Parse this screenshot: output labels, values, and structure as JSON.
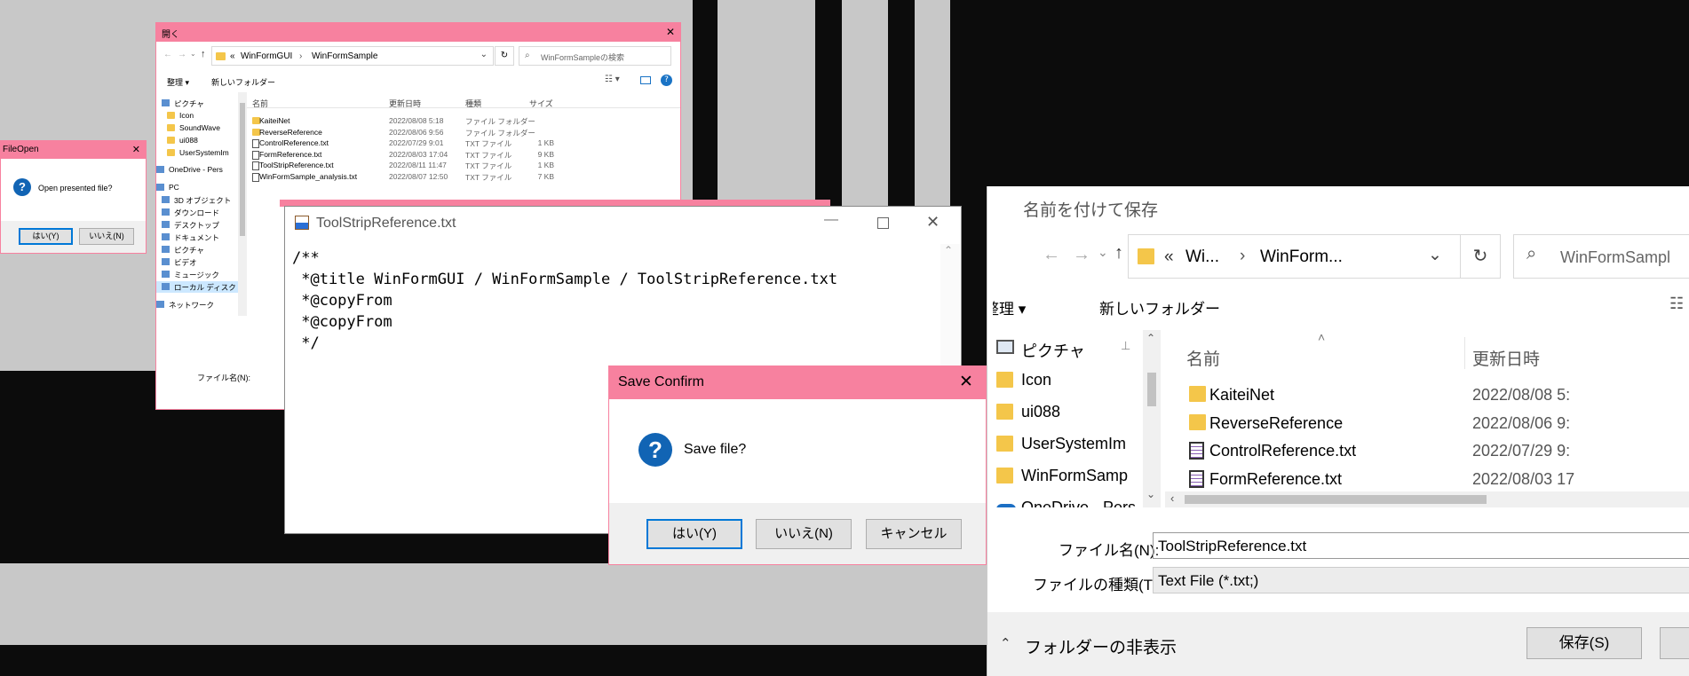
{
  "open_dialog": {
    "title": "開く",
    "close": "✕",
    "path_sep": "«",
    "path1": "WinFormGUI",
    "path_arrow": "›",
    "path2": "WinFormSample",
    "search_placeholder": "WinFormSampleの検索",
    "organize": "整理 ▾",
    "new_folder": "新しいフォルダー",
    "nav_items": [
      {
        "label": "ピクチャ"
      },
      {
        "label": "Icon"
      },
      {
        "label": "SoundWave"
      },
      {
        "label": "ui088"
      },
      {
        "label": "UserSystemIm"
      },
      {
        "label": "OneDrive - Pers"
      },
      {
        "label": "PC"
      },
      {
        "label": "3D オブジェクト"
      },
      {
        "label": "ダウンロード"
      },
      {
        "label": "デスクトップ"
      },
      {
        "label": "ドキュメント"
      },
      {
        "label": "ピクチャ"
      },
      {
        "label": "ビデオ"
      },
      {
        "label": "ミュージック"
      },
      {
        "label": "ローカル ディスク"
      },
      {
        "label": "ネットワーク"
      }
    ],
    "columns": {
      "name": "名前",
      "date": "更新日時",
      "type": "種類",
      "size": "サイズ"
    },
    "files": [
      {
        "name": "KaiteiNet",
        "date": "2022/08/08 5:18",
        "type": "ファイル フォルダー",
        "size": ""
      },
      {
        "name": "ReverseReference",
        "date": "2022/08/06 9:56",
        "type": "ファイル フォルダー",
        "size": ""
      },
      {
        "name": "ControlReference.txt",
        "date": "2022/07/29 9:01",
        "type": "TXT ファイル",
        "size": "1 KB"
      },
      {
        "name": "FormReference.txt",
        "date": "2022/08/03 17:04",
        "type": "TXT ファイル",
        "size": "9 KB"
      },
      {
        "name": "ToolStripReference.txt",
        "date": "2022/08/11 11:47",
        "type": "TXT ファイル",
        "size": "1 KB"
      },
      {
        "name": "WinFormSample_analysis.txt",
        "date": "2022/08/07 12:50",
        "type": "TXT ファイル",
        "size": "7 KB"
      }
    ],
    "filename_label": "ファイル名(N):"
  },
  "fileopen": {
    "title": "FileOpen",
    "message": "Open presented file?",
    "yes": "はい(Y)",
    "no": "いいえ(N)"
  },
  "editor": {
    "title": "ToolStripReference.txt",
    "lines": [
      "/**",
      " *@title WinFormGUI / WinFormSample / ToolStripReference.txt",
      " *@copyFrom",
      " *@copyFrom",
      " */"
    ]
  },
  "save_confirm": {
    "title": "Save Confirm",
    "message": "Save file?",
    "yes": "はい(Y)",
    "no": "いいえ(N)",
    "cancel": "キャンセル"
  },
  "save_dialog": {
    "title": "名前を付けて保存",
    "path_sep": "«",
    "path1": "Wi...",
    "path_arrow": "›",
    "path2": "WinForm...",
    "search_placeholder": "WinFormSampl",
    "organize": "整理 ▾",
    "new_folder": "新しいフォルダー",
    "nav_items": [
      {
        "label": "ピクチャ"
      },
      {
        "label": "Icon"
      },
      {
        "label": "ui088"
      },
      {
        "label": "UserSystemIm"
      },
      {
        "label": "WinFormSamp"
      },
      {
        "label": "OneDrive - Pers"
      }
    ],
    "columns": {
      "name": "名前",
      "date": "更新日時"
    },
    "files": [
      {
        "name": "KaiteiNet",
        "date": "2022/08/08 5:"
      },
      {
        "name": "ReverseReference",
        "date": "2022/08/06 9:"
      },
      {
        "name": "ControlReference.txt",
        "date": "2022/07/29 9:"
      },
      {
        "name": "FormReference.txt",
        "date": "2022/08/03 17"
      }
    ],
    "filename_label": "ファイル名(N):",
    "filename_value": "ToolStripReference.txt",
    "filetype_label": "ファイルの種類(T):",
    "filetype_value": "Text File (*.txt;)",
    "hide_folders": "フォルダーの非表示",
    "save": "保存(S)"
  }
}
